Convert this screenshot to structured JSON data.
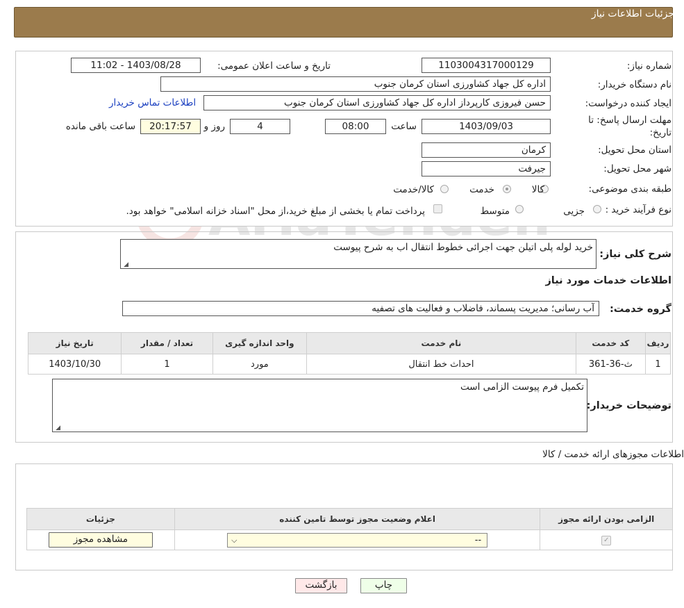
{
  "header": {
    "title": "جزئیات اطلاعات نیاز"
  },
  "form": {
    "need_number": {
      "label": "شماره نیاز:",
      "value": "1103004317000129"
    },
    "announce_datetime": {
      "label": "تاریخ و ساعت اعلان عمومی:",
      "value": "1403/08/28 - 11:02"
    },
    "buyer_org": {
      "label": "نام دستگاه خریدار:",
      "value": "اداره کل جهاد کشاورزی استان کرمان   جنوب"
    },
    "requester": {
      "label": "ایجاد کننده درخواست:",
      "value": "حسن فیروزی کارپرداز اداره کل جهاد کشاورزی استان کرمان   جنوب",
      "contact_link": "اطلاعات تماس خریدار"
    },
    "deadline": {
      "label_line1": "مهلت ارسال پاسخ: تا",
      "label_line2": "تاریخ:",
      "date": "1403/09/03",
      "time_label": "ساعت",
      "time": "08:00",
      "days": "4",
      "days_label": "روز و",
      "remaining": "20:17:57",
      "remaining_label": "ساعت باقی مانده"
    },
    "province": {
      "label": "استان محل تحویل:",
      "value": "کرمان"
    },
    "city": {
      "label": "شهر محل تحویل:",
      "value": "جیرفت"
    },
    "category": {
      "label": "طبقه بندی موضوعی:",
      "options": [
        "کالا",
        "خدمت",
        "کالا/خدمت"
      ],
      "selected": "خدمت"
    },
    "purchase_type": {
      "label": "نوع فرآیند خرید :",
      "options": [
        "جزیی",
        "متوسط"
      ],
      "note": "پرداخت تمام یا بخشی از مبلغ خرید،از محل \"اسناد خزانه اسلامی\" خواهد بود."
    }
  },
  "summary": {
    "label": "شرح کلی نیاز:",
    "value": "خرید لوله پلی اتیلن جهت اجرائی خطوط انتقال اب به شرح پیوست"
  },
  "services": {
    "title": "اطلاعات خدمات مورد نیاز",
    "group_label": "گروه خدمت:",
    "group_value": "آب رسانی؛ مدیریت پسماند، فاضلاب و فعالیت های تصفیه",
    "columns": [
      "ردیف",
      "کد خدمت",
      "نام خدمت",
      "واحد اندازه گیری",
      "تعداد / مقدار",
      "تاریخ نیاز"
    ],
    "rows": [
      [
        "1",
        "ث-36-361",
        "احداث خط انتقال",
        "مورد",
        "1",
        "1403/10/30"
      ]
    ]
  },
  "buyer_notes": {
    "label": "توضیحات خریدار:",
    "value": "تکمیل فرم پیوست الزامی است"
  },
  "permits": {
    "title": "اطلاعات مجوزهای ارائه خدمت / کالا",
    "columns": [
      "الزامی بودن ارائه مجوز",
      "اعلام وضعیت مجوز توسط تامین کننده",
      "جزئیات"
    ],
    "select_value": "--",
    "view_button": "مشاهده مجوز"
  },
  "buttons": {
    "print": "چاپ",
    "back": "بازگشت"
  },
  "watermark": {
    "text": "AriaTender.neT"
  },
  "colors": {
    "header_bg": "#9b7b4c",
    "link": "#1a3fc0",
    "timer_bg": "#fffde0",
    "print_bg": "#efffe8",
    "back_bg": "#ffe8e8"
  }
}
